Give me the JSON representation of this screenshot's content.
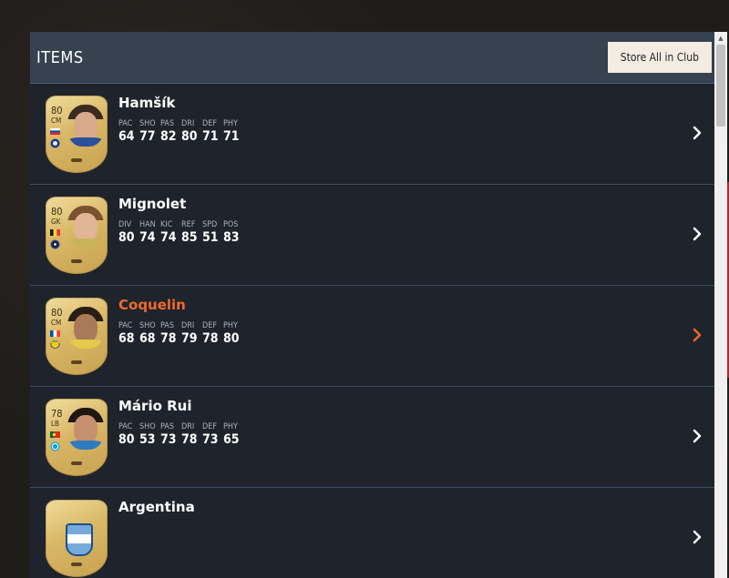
{
  "header": {
    "title": "ITEMS",
    "store_all_label": "Store All in Club"
  },
  "colors": {
    "accent": "#ee6a2c",
    "panel": "#1f242c",
    "header": "#364250",
    "divider": "#3c4c5e"
  },
  "items": [
    {
      "name": "Hamšík",
      "rating": "80",
      "position": "CM",
      "active": false,
      "stats": [
        {
          "label": "PAC",
          "value": "64"
        },
        {
          "label": "SHO",
          "value": "77"
        },
        {
          "label": "PAS",
          "value": "82"
        },
        {
          "label": "DRI",
          "value": "80"
        },
        {
          "label": "DEF",
          "value": "71"
        },
        {
          "label": "PHY",
          "value": "71"
        }
      ]
    },
    {
      "name": "Mignolet",
      "rating": "80",
      "position": "GK",
      "active": false,
      "stats": [
        {
          "label": "DIV",
          "value": "80"
        },
        {
          "label": "HAN",
          "value": "74"
        },
        {
          "label": "KIC",
          "value": "74"
        },
        {
          "label": "REF",
          "value": "85"
        },
        {
          "label": "SPD",
          "value": "51"
        },
        {
          "label": "POS",
          "value": "83"
        }
      ]
    },
    {
      "name": "Coquelin",
      "rating": "80",
      "position": "CM",
      "active": true,
      "stats": [
        {
          "label": "PAC",
          "value": "68"
        },
        {
          "label": "SHO",
          "value": "68"
        },
        {
          "label": "PAS",
          "value": "78"
        },
        {
          "label": "DRI",
          "value": "79"
        },
        {
          "label": "DEF",
          "value": "78"
        },
        {
          "label": "PHY",
          "value": "80"
        }
      ]
    },
    {
      "name": "Mário Rui",
      "rating": "78",
      "position": "LB",
      "active": false,
      "stats": [
        {
          "label": "PAC",
          "value": "80"
        },
        {
          "label": "SHO",
          "value": "53"
        },
        {
          "label": "PAS",
          "value": "73"
        },
        {
          "label": "DRI",
          "value": "78"
        },
        {
          "label": "DEF",
          "value": "73"
        },
        {
          "label": "PHY",
          "value": "65"
        }
      ]
    },
    {
      "name": "Argentina",
      "active": false
    }
  ]
}
